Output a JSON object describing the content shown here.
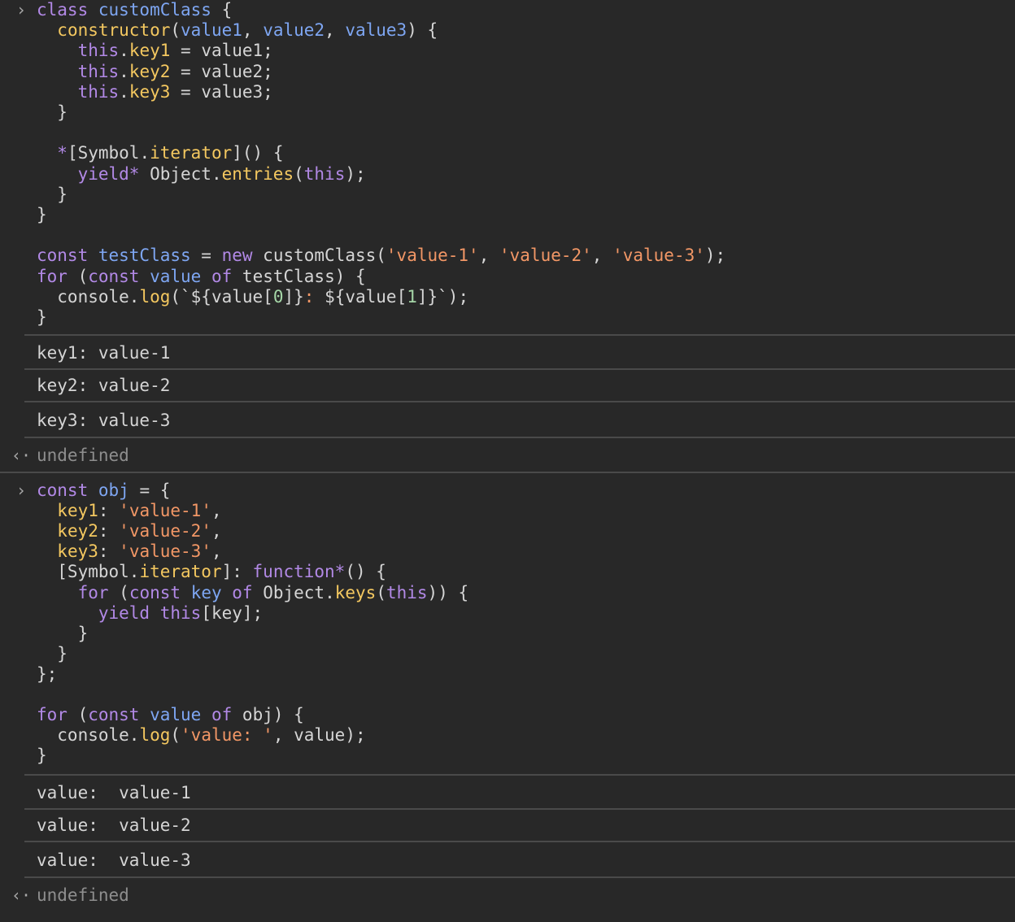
{
  "prompt_glyph": "›",
  "result_glyph": "‹·",
  "block1": {
    "lines": [
      [
        [
          "k",
          "class "
        ],
        [
          "t",
          "customClass"
        ],
        [
          "p",
          " {"
        ]
      ],
      [
        [
          "p",
          "  "
        ],
        [
          "f",
          "constructor"
        ],
        [
          "p",
          "("
        ],
        [
          "t",
          "value1"
        ],
        [
          "p",
          ", "
        ],
        [
          "t",
          "value2"
        ],
        [
          "p",
          ", "
        ],
        [
          "t",
          "value3"
        ],
        [
          "p",
          ") {"
        ]
      ],
      [
        [
          "p",
          "    "
        ],
        [
          "k",
          "this"
        ],
        [
          "p",
          "."
        ],
        [
          "f",
          "key1"
        ],
        [
          "p",
          " = value1;"
        ]
      ],
      [
        [
          "p",
          "    "
        ],
        [
          "k",
          "this"
        ],
        [
          "p",
          "."
        ],
        [
          "f",
          "key2"
        ],
        [
          "p",
          " = value2;"
        ]
      ],
      [
        [
          "p",
          "    "
        ],
        [
          "k",
          "this"
        ],
        [
          "p",
          "."
        ],
        [
          "f",
          "key3"
        ],
        [
          "p",
          " = value3;"
        ]
      ],
      [
        [
          "p",
          "  }"
        ]
      ],
      [
        [
          "p",
          ""
        ]
      ],
      [
        [
          "p",
          "  "
        ],
        [
          "k",
          "*"
        ],
        [
          "p",
          "[Symbol."
        ],
        [
          "f",
          "iterator"
        ],
        [
          "p",
          "]() {"
        ]
      ],
      [
        [
          "p",
          "    "
        ],
        [
          "k",
          "yield*"
        ],
        [
          "p",
          " Object."
        ],
        [
          "f",
          "entries"
        ],
        [
          "p",
          "("
        ],
        [
          "k",
          "this"
        ],
        [
          "p",
          ");"
        ]
      ],
      [
        [
          "p",
          "  }"
        ]
      ],
      [
        [
          "p",
          "}"
        ]
      ],
      [
        [
          "p",
          ""
        ]
      ],
      [
        [
          "k",
          "const "
        ],
        [
          "t",
          "testClass"
        ],
        [
          "p",
          " = "
        ],
        [
          "k",
          "new"
        ],
        [
          "p",
          " customClass("
        ],
        [
          "s",
          "'value-1'"
        ],
        [
          "p",
          ", "
        ],
        [
          "s",
          "'value-2'"
        ],
        [
          "p",
          ", "
        ],
        [
          "s",
          "'value-3'"
        ],
        [
          "p",
          ");"
        ]
      ],
      [
        [
          "k",
          "for"
        ],
        [
          "p",
          " ("
        ],
        [
          "k",
          "const"
        ],
        [
          "p",
          " "
        ],
        [
          "t",
          "value"
        ],
        [
          "p",
          " "
        ],
        [
          "k",
          "of"
        ],
        [
          "p",
          " testClass) {"
        ]
      ],
      [
        [
          "p",
          "  console."
        ],
        [
          "f",
          "log"
        ],
        [
          "p",
          "(`${value["
        ],
        [
          "n",
          "0"
        ],
        [
          "p",
          "]}"
        ],
        [
          "s",
          ": "
        ],
        [
          "p",
          "${value["
        ],
        [
          "n",
          "1"
        ],
        [
          "p",
          "]}`);"
        ]
      ],
      [
        [
          "p",
          "}"
        ]
      ]
    ],
    "outputs": [
      "key1: value-1",
      "key2: value-2",
      "key3: value-3"
    ],
    "result": "undefined"
  },
  "block2": {
    "lines": [
      [
        [
          "k",
          "const "
        ],
        [
          "t",
          "obj"
        ],
        [
          "p",
          " = {"
        ]
      ],
      [
        [
          "p",
          "  "
        ],
        [
          "f",
          "key1"
        ],
        [
          "p",
          ": "
        ],
        [
          "s",
          "'value-1'"
        ],
        [
          "p",
          ","
        ]
      ],
      [
        [
          "p",
          "  "
        ],
        [
          "f",
          "key2"
        ],
        [
          "p",
          ": "
        ],
        [
          "s",
          "'value-2'"
        ],
        [
          "p",
          ","
        ]
      ],
      [
        [
          "p",
          "  "
        ],
        [
          "f",
          "key3"
        ],
        [
          "p",
          ": "
        ],
        [
          "s",
          "'value-3'"
        ],
        [
          "p",
          ","
        ]
      ],
      [
        [
          "p",
          "  [Symbol."
        ],
        [
          "f",
          "iterator"
        ],
        [
          "p",
          "]: "
        ],
        [
          "k",
          "function*"
        ],
        [
          "p",
          "() {"
        ]
      ],
      [
        [
          "p",
          "    "
        ],
        [
          "k",
          "for"
        ],
        [
          "p",
          " ("
        ],
        [
          "k",
          "const"
        ],
        [
          "p",
          " "
        ],
        [
          "t",
          "key"
        ],
        [
          "p",
          " "
        ],
        [
          "k",
          "of"
        ],
        [
          "p",
          " Object."
        ],
        [
          "f",
          "keys"
        ],
        [
          "p",
          "("
        ],
        [
          "k",
          "this"
        ],
        [
          "p",
          ")) {"
        ]
      ],
      [
        [
          "p",
          "      "
        ],
        [
          "k",
          "yield"
        ],
        [
          "p",
          " "
        ],
        [
          "k",
          "this"
        ],
        [
          "p",
          "[key];"
        ]
      ],
      [
        [
          "p",
          "    }"
        ]
      ],
      [
        [
          "p",
          "  }"
        ]
      ],
      [
        [
          "p",
          "};"
        ]
      ],
      [
        [
          "p",
          ""
        ]
      ],
      [
        [
          "k",
          "for"
        ],
        [
          "p",
          " ("
        ],
        [
          "k",
          "const"
        ],
        [
          "p",
          " "
        ],
        [
          "t",
          "value"
        ],
        [
          "p",
          " "
        ],
        [
          "k",
          "of"
        ],
        [
          "p",
          " obj) {"
        ]
      ],
      [
        [
          "p",
          "  console."
        ],
        [
          "f",
          "log"
        ],
        [
          "p",
          "("
        ],
        [
          "s",
          "'value: '"
        ],
        [
          "p",
          ", value);"
        ]
      ],
      [
        [
          "p",
          "}"
        ]
      ]
    ],
    "outputs": [
      "value:  value-1",
      "value:  value-2",
      "value:  value-3"
    ],
    "result": "undefined"
  },
  "colors": {
    "background": "#282828",
    "keyword": "#b289e6",
    "definition": "#7ea6f2",
    "property": "#f4c860",
    "string": "#f29766",
    "plain": "#d5d5d5",
    "muted": "#8e8e8e",
    "separator": "#4a4a4a"
  }
}
